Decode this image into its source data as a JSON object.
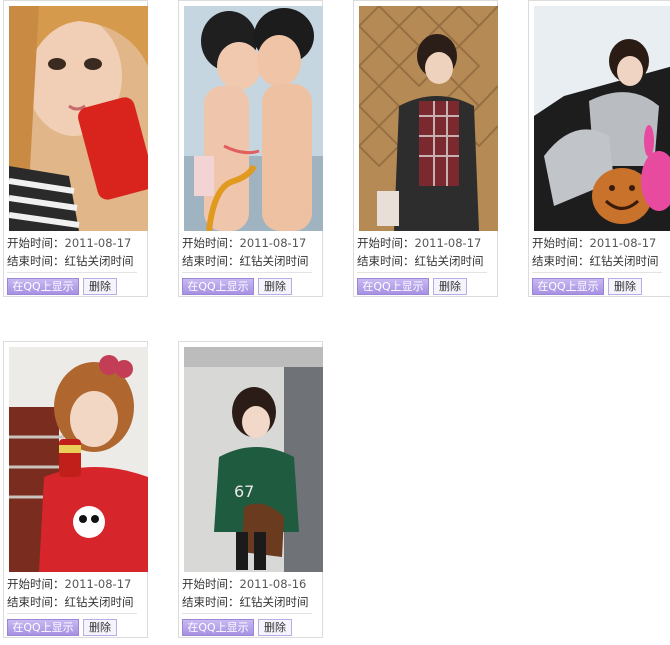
{
  "labels": {
    "start": "开始时间：",
    "end": "结束时间：",
    "show_button": "在QQ上显示",
    "delete_button": "删除"
  },
  "cards": [
    {
      "start_date": "2011-08-17",
      "end_text": "红钻关闭时间",
      "image": "photo-girl-with-cola-can"
    },
    {
      "start_date": "2011-08-17",
      "end_text": "红钻关闭时间",
      "image": "photo-two-children"
    },
    {
      "start_date": "2011-08-17",
      "end_text": "红钻关闭时间",
      "image": "photo-girl-plaid-shirt"
    },
    {
      "start_date": "2011-08-17",
      "end_text": "红钻关闭时间",
      "image": "photo-girl-in-car"
    },
    {
      "start_date": "2011-08-17",
      "end_text": "红钻关闭时间",
      "image": "photo-girl-red-shirt"
    },
    {
      "start_date": "2011-08-16",
      "end_text": "红钻关闭时间",
      "image": "photo-girl-green-hoodie"
    }
  ]
}
